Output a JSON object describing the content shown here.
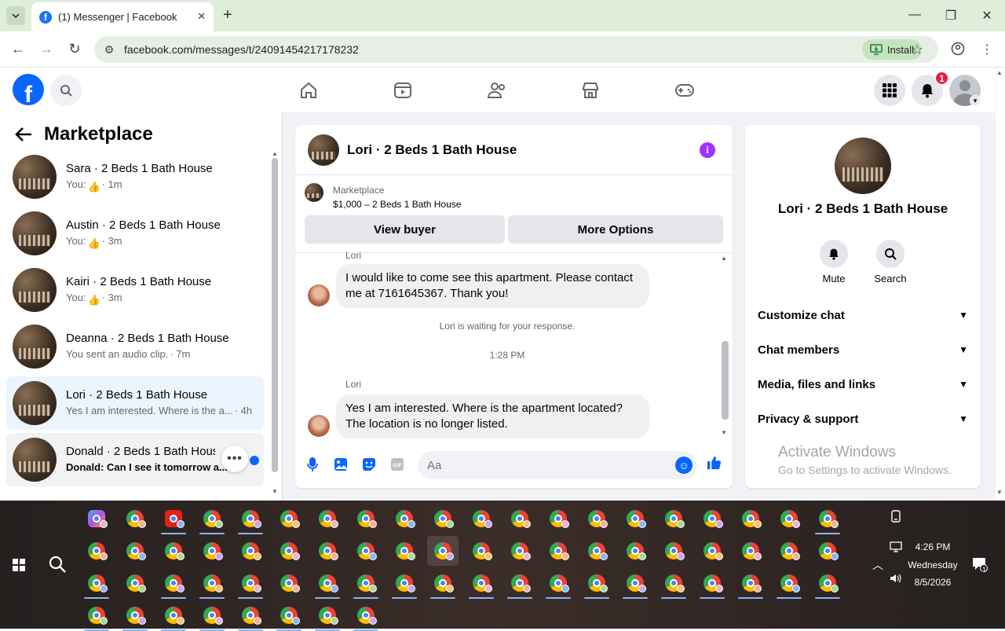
{
  "browser": {
    "tab_title": "(1) Messenger | Facebook",
    "new_tab": "+",
    "url": "facebook.com/messages/t/24091454217178232",
    "install_label": "Install"
  },
  "facebook": {
    "notification_count": "1"
  },
  "sidebar": {
    "title": "Marketplace",
    "conversations": [
      {
        "name": "Sara · 2 Beds 1 Bath House",
        "prefix": "You:",
        "preview": "",
        "time": "· 1m",
        "like": true,
        "active": false,
        "unread": false
      },
      {
        "name": "Austin · 2 Beds 1 Bath House",
        "prefix": "You:",
        "preview": "",
        "time": "· 3m",
        "like": true,
        "active": false,
        "unread": false
      },
      {
        "name": "Kairi · 2 Beds 1 Bath House",
        "prefix": "You:",
        "preview": "",
        "time": "· 3m",
        "like": true,
        "active": false,
        "unread": false
      },
      {
        "name": "Deanna · 2 Beds 1 Bath House",
        "prefix": "",
        "preview": "You sent an audio clip.",
        "time": "· 7m",
        "like": false,
        "active": false,
        "unread": false
      },
      {
        "name": "Lori · 2 Beds 1 Bath House",
        "prefix": "",
        "preview": "Yes I am interested. Where is the a...",
        "time": "· 4h",
        "like": false,
        "active": true,
        "unread": false
      },
      {
        "name": "Donald · 2 Beds 1 Bath House",
        "prefix": "",
        "preview": "Donald: Can I see it tomorrow a...",
        "time": "",
        "like": false,
        "active": false,
        "unread": true
      }
    ],
    "more_dots": "•••"
  },
  "chat": {
    "title": "Lori · 2 Beds 1 Bath House",
    "info_icon": "i",
    "listing_source": "Marketplace",
    "listing_title": "$1,000 – 2 Beds 1 Bath House",
    "view_buyer": "View buyer",
    "more_options": "More Options",
    "messages": [
      {
        "sender": "Lori",
        "text": "I would like to come see this apartment. Please contact me at 7161645367. Thank you!"
      },
      {
        "sender": "Lori",
        "text": "Yes I am interested. Where is the apartment located? The location is no longer listed."
      }
    ],
    "waiting_notice": "Lori is waiting for your response.",
    "timestamp": "1:28 PM",
    "input_placeholder": "Aa",
    "gif_label": "GIF"
  },
  "details": {
    "name": "Lori · 2 Beds 1 Bath House",
    "actions": [
      {
        "label": "Mute",
        "icon": "bell-icon"
      },
      {
        "label": "Search",
        "icon": "search-icon"
      }
    ],
    "sections": [
      {
        "label": "Customize chat"
      },
      {
        "label": "Chat members"
      },
      {
        "label": "Media, files and links"
      },
      {
        "label": "Privacy & support"
      }
    ]
  },
  "watermark": {
    "line1": "Activate Windows",
    "line2": "Go to Settings to activate Windows."
  },
  "taskbar": {
    "time": "4:26 PM",
    "day": "Wednesday",
    "date": "8/5/2026",
    "notification_count": "1"
  }
}
